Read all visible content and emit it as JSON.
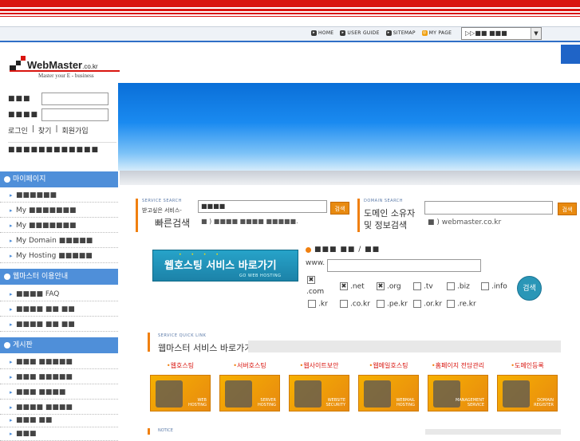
{
  "top_links": [
    {
      "icon": "home-icon",
      "label": "HOME"
    },
    {
      "icon": "user-guide-icon",
      "label": "USER GUIDE"
    },
    {
      "icon": "sitemap-icon",
      "label": "SITEMAP"
    },
    {
      "icon": "my-page-icon",
      "label": "MY PAGE"
    }
  ],
  "site_select": {
    "value": "▷▷■■ ■■■"
  },
  "logo": {
    "name": "WebMaster",
    "suffix": ".co.kr",
    "tagline": "Master your E - business"
  },
  "login": {
    "id_label": "■■■",
    "pw_label": "■■■■",
    "links": [
      "로그인",
      "|",
      "찾기",
      "|",
      "회원가입"
    ],
    "bottom_text": "■■■■■■■■■■■■"
  },
  "menu": [
    {
      "title": "마이페이지",
      "items": [
        "■■■■■■",
        "My ■■■■■■■",
        "My ■■■■■■■",
        "My Domain ■■■■■",
        "My Hosting ■■■■■"
      ]
    },
    {
      "title": "웹마스터 이용안내",
      "items": [
        "■■■■ FAQ",
        "■■■■ ■■ ■■",
        "■■■■ ■■ ■■"
      ]
    },
    {
      "title": "게시판",
      "items": [
        "■■■ ■■■■■",
        "■■■ ■■■■■",
        "■■■ ■■■■",
        "■■■■ ■■■■",
        "■■■ ■■",
        "■■■"
      ]
    }
  ],
  "service_search": {
    "eng": "SERVICE SEARCH",
    "sub": "받고싶은 서비스-",
    "title": "빠른검색",
    "input_value": "■■■■",
    "button": "검색",
    "note": "■ ) ■■■■ ■■■■ ■■■■■."
  },
  "domain_search": {
    "eng": "DOMAIN SEARCH",
    "title_line1": "도메인 소유자",
    "title_line2": "및 정보검색",
    "input_value": "",
    "button": "검색",
    "note": "■ ) webmaster.co.kr"
  },
  "web_hosting_button": {
    "label": "웹호스팅 서비스 바로가기",
    "sub": "GO WEB HOSTING",
    "dots": "• • • •"
  },
  "domain_register": {
    "heading": "■■■ ■■ / ■■",
    "www_label": "www.",
    "tlds": [
      {
        "label": ".com",
        "checked": true
      },
      {
        "label": ".net",
        "checked": true
      },
      {
        "label": ".org",
        "checked": true
      },
      {
        "label": ".tv",
        "checked": false
      },
      {
        "label": ".biz",
        "checked": false
      },
      {
        "label": ".info",
        "checked": false
      },
      {
        "label": ".kr",
        "checked": false
      },
      {
        "label": ".co.kr",
        "checked": false
      },
      {
        "label": ".pe.kr",
        "checked": false
      },
      {
        "label": ".or.kr",
        "checked": false
      },
      {
        "label": ".re.kr",
        "checked": false
      }
    ],
    "search_button": "검색"
  },
  "quick_link": {
    "eng": "SERVICE QUICK LINK",
    "title": "웹마스터 서비스 바로가기"
  },
  "services": [
    {
      "label": "웹호스팅",
      "caption": "WEB HOSTING"
    },
    {
      "label": "서버호스팅",
      "caption": "SERVER HOSTING"
    },
    {
      "label": "웹사이트보안",
      "caption": "WEBSITE SECURITY"
    },
    {
      "label": "웹메일호스팅",
      "caption": "WEBMAIL HOSTING"
    },
    {
      "label": "홈페이지 전담관리",
      "caption": "MANAGEMENT SERVICE"
    },
    {
      "label": "도메인등록",
      "caption": "DOMAIN REGISTER"
    }
  ],
  "notice": {
    "eng": "NOTICE"
  },
  "colors": {
    "brand_red": "#d9150f",
    "accent_orange": "#f08010",
    "menu_blue": "#4f8fd9",
    "hero_blue": "#0a6fd8",
    "teal": "#2a96b7"
  }
}
